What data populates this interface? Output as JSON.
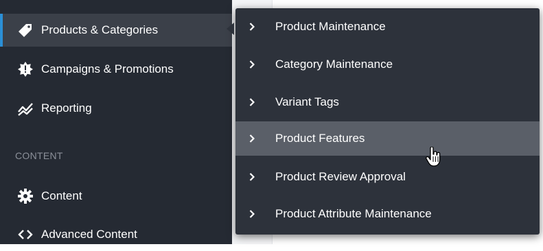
{
  "sidebar": {
    "items": [
      {
        "label": "Products & Categories",
        "icon": "tag-icon",
        "active": true
      },
      {
        "label": "Campaigns & Promotions",
        "icon": "badge-icon"
      },
      {
        "label": "Reporting",
        "icon": "trend-chart-icon"
      }
    ],
    "section_label": "CONTENT",
    "content_items": [
      {
        "label": "Content",
        "icon": "gear-icon"
      },
      {
        "label": "Advanced Content",
        "icon": "code-icon"
      }
    ]
  },
  "flyout": {
    "items": [
      {
        "label": "Product Maintenance"
      },
      {
        "label": "Category Maintenance"
      },
      {
        "label": "Variant Tags"
      },
      {
        "label": "Product Features",
        "hover": true
      },
      {
        "label": "Product Review Approval"
      },
      {
        "label": "Product Attribute Maintenance"
      }
    ]
  },
  "colors": {
    "sidebar_bg": "#252a33",
    "active_bg": "#3b4049",
    "active_accent": "#2b8fd6",
    "flyout_bg": "#2d323b",
    "hover_bg": "#5a5f68"
  }
}
